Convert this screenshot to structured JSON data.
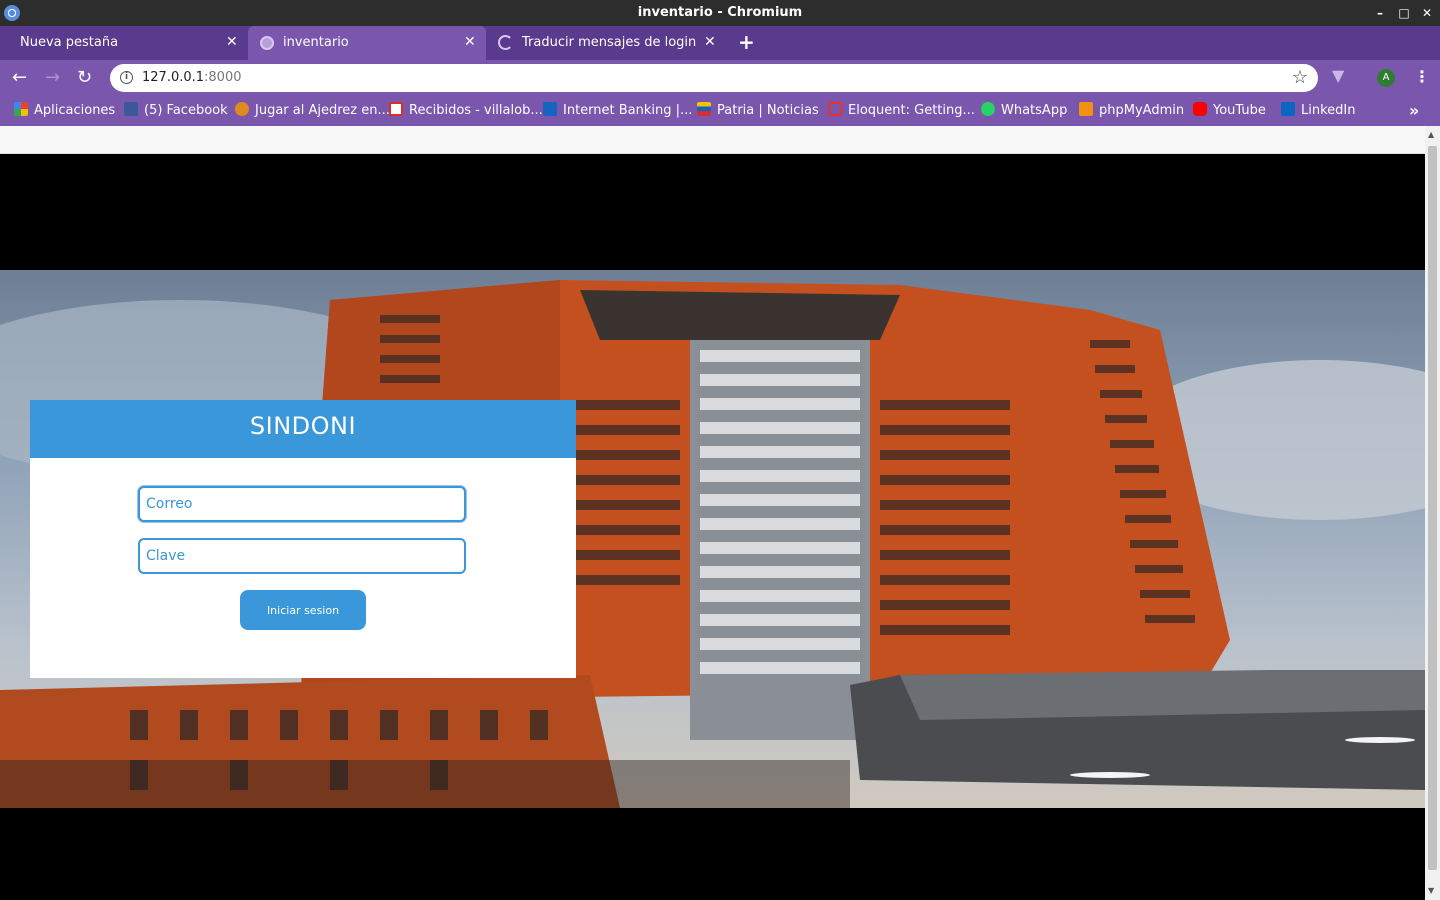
{
  "window": {
    "title": "inventario - Chromium"
  },
  "tabs": [
    {
      "label": "Nueva pestaña",
      "state": "inactive"
    },
    {
      "label": "inventario",
      "state": "active"
    },
    {
      "label": "Traducir mensajes de login y au",
      "state": "loading"
    }
  ],
  "omnibox": {
    "host": "127.0.0.1",
    "port": ":8000"
  },
  "profile": {
    "initial": "A"
  },
  "bookmarks": [
    {
      "label": "Aplicaciones",
      "icon": "apps-grid-icon",
      "color": "#e94235"
    },
    {
      "label": "(5) Facebook",
      "icon": "facebook-icon",
      "color": "#3b5998"
    },
    {
      "label": "Jugar al Ajedrez en...",
      "icon": "chess-icon",
      "color": "#e08a1e"
    },
    {
      "label": "Recibidos - villalob...",
      "icon": "gmail-icon",
      "color": "#d93025"
    },
    {
      "label": "Internet Banking |...",
      "icon": "bank-icon",
      "color": "#1565c0"
    },
    {
      "label": "Patria | Noticias",
      "icon": "patria-icon",
      "color": "#f2c200"
    },
    {
      "label": "Eloquent: Getting...",
      "icon": "laravel-icon",
      "color": "#e3342f"
    },
    {
      "label": "WhatsApp",
      "icon": "whatsapp-icon",
      "color": "#25d366"
    },
    {
      "label": "phpMyAdmin",
      "icon": "phpmyadmin-icon",
      "color": "#f29111"
    },
    {
      "label": "YouTube",
      "icon": "youtube-icon",
      "color": "#ff0000"
    },
    {
      "label": "LinkedIn",
      "icon": "linkedin-icon",
      "color": "#0a66c2"
    }
  ],
  "login": {
    "title": "SINDONI",
    "email_placeholder": "Correo",
    "password_placeholder": "Clave",
    "submit_label": "Iniciar sesion"
  },
  "colors": {
    "accent": "#3a97d9",
    "browser_frame": "#7a57ad"
  }
}
